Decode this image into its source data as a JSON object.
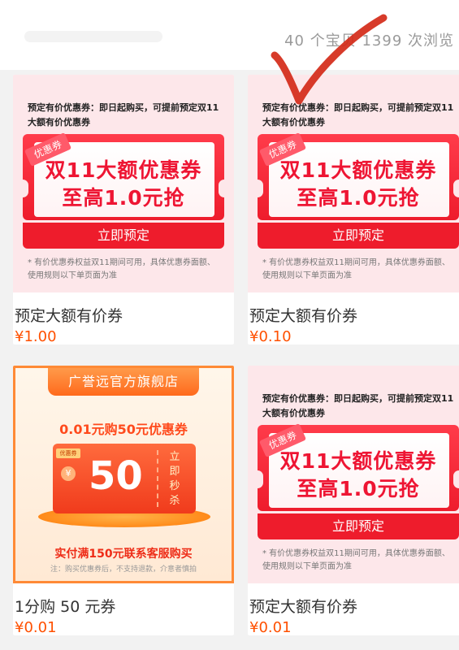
{
  "header": {
    "stats": "40 个宝贝  1399 次浏览"
  },
  "products": [
    {
      "banner": "pink",
      "banner_head": "预定有价优惠券：即日起购买，可提前预定双11大额有价优惠券",
      "tag": "优惠券",
      "big1": "双11大额优惠券",
      "big2": "至高1.0元抢",
      "button": "立即预定",
      "footnote": "* 有价优惠券权益双11期间可用，具体优惠券面额、使用规则以下单页面为准",
      "title": "预定大额有价券",
      "price": "¥1.00"
    },
    {
      "banner": "pink",
      "banner_head": "预定有价优惠券：即日起购买，可提前预定双11大额有价优惠券",
      "tag": "优惠券",
      "big1": "双11大额优惠券",
      "big2": "至高1.0元抢",
      "button": "立即预定",
      "footnote": "* 有价优惠券权益双11期间可用，具体优惠券面额、使用规则以下单页面为准",
      "title": "预定大额有价券",
      "price": "¥0.10"
    },
    {
      "banner": "orange",
      "store": "广誉远官方旗舰店",
      "sub": "0.01元购50元优惠券",
      "coupon_tag": "优惠券",
      "amount": "50",
      "side": "立即秒杀",
      "cta": "实付满150元联系客服购买",
      "note": "注：购买优惠券后，不支持退款，介意者慎拍",
      "title": "1分购 50 元券",
      "price": "¥0.01"
    },
    {
      "banner": "pink",
      "banner_head": "预定有价优惠券：即日起购买，可提前预定双11大额有价优惠券",
      "tag": "优惠券",
      "big1": "双11大额优惠券",
      "big2": "至高1.0元抢",
      "button": "立即预定",
      "footnote": "* 有价优惠券权益双11期间可用，具体优惠券面额、使用规则以下单页面为准",
      "title": "预定大额有价券",
      "price": "¥0.01"
    }
  ],
  "colors": {
    "accent_red": "#ee1c2c",
    "price": "#ff5000",
    "checkmark": "#d42a18"
  },
  "icons": [
    "checkmark-annotation",
    "yen-icon"
  ]
}
